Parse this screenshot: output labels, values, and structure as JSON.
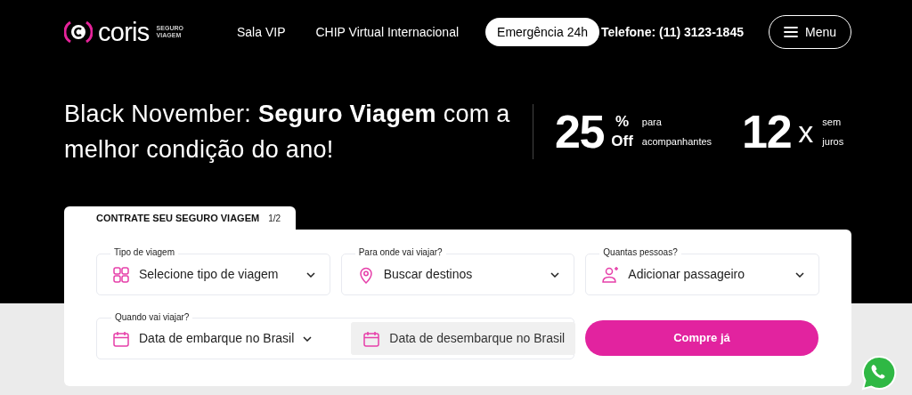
{
  "header": {
    "logo": {
      "name": "coris",
      "tagline": [
        "SEGURO",
        "VIAGEM"
      ]
    },
    "nav": [
      {
        "label": "Sala VIP",
        "kind": "link"
      },
      {
        "label": "CHIP Virtual Internacional",
        "kind": "link"
      },
      {
        "label": "Emergência 24h",
        "kind": "pill"
      }
    ],
    "phone": "Telefone: (11) 3123-1845",
    "menu_button": "Menu"
  },
  "hero": {
    "headline": "Black November: **Seguro Viagem** com a melhor condição do ano!",
    "offers": [
      {
        "kind": "percent",
        "big": "25",
        "suffix": [
          "%",
          "Off"
        ],
        "caption": [
          "para",
          "acompanhantes"
        ]
      },
      {
        "kind": "installments",
        "big": "12",
        "suffix": [
          "x"
        ],
        "caption": [
          "sem",
          "juros"
        ]
      }
    ]
  },
  "form": {
    "tab": {
      "title": "CONTRATE SEU SEGURO VIAGEM",
      "step": "1/2"
    },
    "fields": [
      {
        "kind": "trip-type",
        "label": "Tipo de viagem",
        "value": "Selecione tipo de viagem"
      },
      {
        "kind": "destination",
        "label": "Para onde vai viajar?",
        "value": "Buscar destinos"
      },
      {
        "kind": "passengers",
        "label": "Quantas pessoas?",
        "value": "Adicionar passageiro"
      }
    ],
    "dates": {
      "label": "Quando vai viajar?",
      "parts": [
        {
          "value": "Data de embarque no Brasil",
          "disabled": false
        },
        {
          "value": "Data de desembarque no Brasil",
          "disabled": true
        }
      ]
    },
    "submit": "Compre já"
  }
}
